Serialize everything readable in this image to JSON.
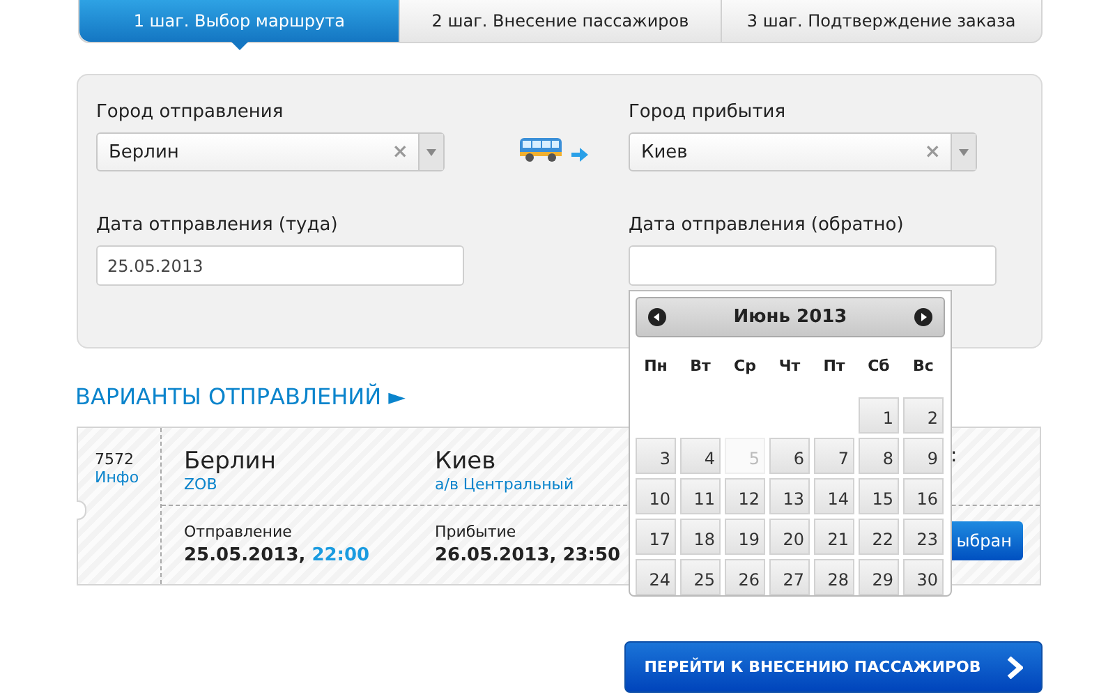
{
  "steps": [
    {
      "label": "1 шаг. Выбор маршрута",
      "selected": true
    },
    {
      "label": "2 шаг. Внесение пассажиров",
      "selected": false
    },
    {
      "label": "3 шаг. Подтверждение заказа",
      "selected": false
    }
  ],
  "form": {
    "from_label": "Город отправления",
    "from_value": "Берлин",
    "clear_icon": "×",
    "to_label": "Город прибытия",
    "to_value": "Киев",
    "date_there_label": "Дата отправления (туда)",
    "date_there_value": "25.05.2013",
    "date_back_label": "Дата отправления (обратно)"
  },
  "calendar": {
    "month": "Июнь 2013",
    "weekdays": [
      "Пн",
      "Вт",
      "Ср",
      "Чт",
      "Пт",
      "Сб",
      "Вс"
    ],
    "weeks": [
      [
        {
          "day": "1",
          "disabled": false
        },
        {
          "day": "2",
          "disabled": false
        }
      ],
      [
        {
          "day": "3",
          "disabled": false
        },
        {
          "day": "4",
          "disabled": false
        },
        {
          "day": "5",
          "disabled": true
        },
        {
          "day": "6",
          "disabled": false
        },
        {
          "day": "7",
          "disabled": false
        },
        {
          "day": "8",
          "disabled": false
        },
        {
          "day": "9",
          "disabled": false
        }
      ],
      [
        {
          "day": "10",
          "disabled": false
        },
        {
          "day": "11",
          "disabled": false
        },
        {
          "day": "12",
          "disabled": false
        },
        {
          "day": "13",
          "disabled": false
        },
        {
          "day": "14",
          "disabled": false
        },
        {
          "day": "15",
          "disabled": false
        },
        {
          "day": "16",
          "disabled": false
        }
      ],
      [
        {
          "day": "17",
          "disabled": false
        },
        {
          "day": "18",
          "disabled": false
        },
        {
          "day": "19",
          "disabled": false
        },
        {
          "day": "20",
          "disabled": false
        },
        {
          "day": "21",
          "disabled": false
        },
        {
          "day": "22",
          "disabled": false
        },
        {
          "day": "23",
          "disabled": false
        }
      ],
      [
        {
          "day": "24",
          "disabled": false
        },
        {
          "day": "25",
          "disabled": false
        },
        {
          "day": "26",
          "disabled": false
        },
        {
          "day": "27",
          "disabled": false
        },
        {
          "day": "28",
          "disabled": false
        },
        {
          "day": "29",
          "disabled": false
        },
        {
          "day": "30",
          "disabled": false
        }
      ]
    ]
  },
  "results_heading": "ВАРИАНТЫ ОТПРАВЛЕНИЙ ►",
  "trip": {
    "number": "7572",
    "info_link": "Инфо",
    "from_city": "Берлин",
    "from_station": "ZOB",
    "to_city": "Киев",
    "to_station": "а/в Центральный",
    "departure_label": "Отправление",
    "departure_date": "25.05.2013,",
    "departure_time": "22:00",
    "arrival_label": "Прибытие",
    "arrival_datetime": "26.05.2013, 23:50",
    "column_3_text": ":",
    "select_button": "ыбран"
  },
  "next_button": "ПЕРЕЙТИ К ВНЕСЕНИЮ ПАССАЖИРОВ"
}
